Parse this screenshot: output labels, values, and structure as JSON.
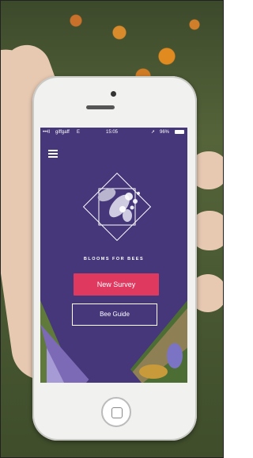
{
  "status_bar": {
    "carrier": "giffgaff",
    "network": "E",
    "time": "15:05",
    "battery": "96%"
  },
  "app": {
    "brand": "BLOOMS FOR BEES",
    "primary_button_label": "New Survey",
    "secondary_button_label": "Bee Guide"
  },
  "colors": {
    "app_background": "#46377a",
    "accent": "#e0395f"
  },
  "icons": [
    "menu-icon",
    "bee-flower-logo",
    "location-arrow-icon",
    "battery-icon"
  ]
}
